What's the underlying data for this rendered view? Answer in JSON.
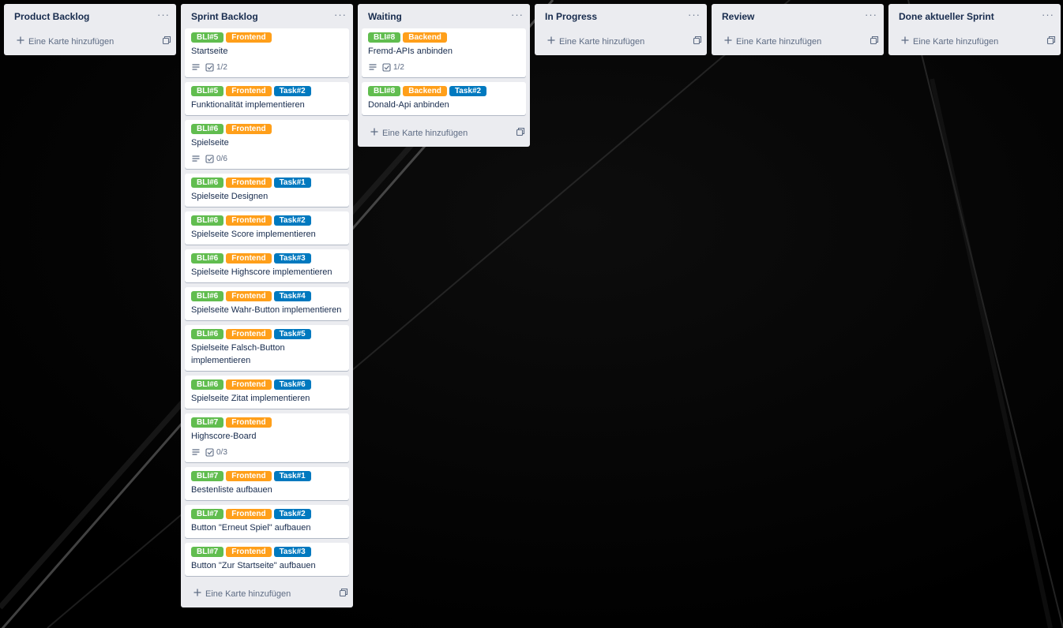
{
  "lists": [
    {
      "title": "Product Backlog",
      "menu_icon": "more-icon",
      "cards": [],
      "add_card_label": "Eine Karte hinzufügen"
    },
    {
      "title": "Sprint Backlog",
      "menu_icon": "more-icon",
      "cards": [
        {
          "labels": [
            {
              "text": "BLI#5",
              "kind": "bli"
            },
            {
              "text": "Frontend",
              "kind": "area"
            }
          ],
          "title": "Startseite",
          "has_description": true,
          "checklist": "1/2"
        },
        {
          "labels": [
            {
              "text": "BLI#5",
              "kind": "bli"
            },
            {
              "text": "Frontend",
              "kind": "area"
            },
            {
              "text": "Task#2",
              "kind": "task"
            }
          ],
          "title": "Funktionalität implementieren"
        },
        {
          "labels": [
            {
              "text": "BLI#6",
              "kind": "bli"
            },
            {
              "text": "Frontend",
              "kind": "area"
            }
          ],
          "title": "Spielseite",
          "has_description": true,
          "checklist": "0/6"
        },
        {
          "labels": [
            {
              "text": "BLI#6",
              "kind": "bli"
            },
            {
              "text": "Frontend",
              "kind": "area"
            },
            {
              "text": "Task#1",
              "kind": "task"
            }
          ],
          "title": "Spielseite Designen"
        },
        {
          "labels": [
            {
              "text": "BLI#6",
              "kind": "bli"
            },
            {
              "text": "Frontend",
              "kind": "area"
            },
            {
              "text": "Task#2",
              "kind": "task"
            }
          ],
          "title": "Spielseite Score implementieren"
        },
        {
          "labels": [
            {
              "text": "BLI#6",
              "kind": "bli"
            },
            {
              "text": "Frontend",
              "kind": "area"
            },
            {
              "text": "Task#3",
              "kind": "task"
            }
          ],
          "title": "Spielseite Highscore implementieren"
        },
        {
          "labels": [
            {
              "text": "BLI#6",
              "kind": "bli"
            },
            {
              "text": "Frontend",
              "kind": "area"
            },
            {
              "text": "Task#4",
              "kind": "task"
            }
          ],
          "title": "Spielseite Wahr-Button implementieren"
        },
        {
          "labels": [
            {
              "text": "BLI#6",
              "kind": "bli"
            },
            {
              "text": "Frontend",
              "kind": "area"
            },
            {
              "text": "Task#5",
              "kind": "task"
            }
          ],
          "title": "Spielseite Falsch-Button implementieren"
        },
        {
          "labels": [
            {
              "text": "BLI#6",
              "kind": "bli"
            },
            {
              "text": "Frontend",
              "kind": "area"
            },
            {
              "text": "Task#6",
              "kind": "task"
            }
          ],
          "title": "Spielseite Zitat implementieren"
        },
        {
          "labels": [
            {
              "text": "BLI#7",
              "kind": "bli"
            },
            {
              "text": "Frontend",
              "kind": "area"
            }
          ],
          "title": "Highscore-Board",
          "has_description": true,
          "checklist": "0/3"
        },
        {
          "labels": [
            {
              "text": "BLI#7",
              "kind": "bli"
            },
            {
              "text": "Frontend",
              "kind": "area"
            },
            {
              "text": "Task#1",
              "kind": "task"
            }
          ],
          "title": "Bestenliste aufbauen"
        },
        {
          "labels": [
            {
              "text": "BLI#7",
              "kind": "bli"
            },
            {
              "text": "Frontend",
              "kind": "area"
            },
            {
              "text": "Task#2",
              "kind": "task"
            }
          ],
          "title": "Button \"Erneut Spiel\" aufbauen"
        },
        {
          "labels": [
            {
              "text": "BLI#7",
              "kind": "bli"
            },
            {
              "text": "Frontend",
              "kind": "area"
            },
            {
              "text": "Task#3",
              "kind": "task"
            }
          ],
          "title": "Button \"Zur Startseite\" aufbauen"
        }
      ],
      "add_card_label": "Eine Karte hinzufügen"
    },
    {
      "title": "Waiting",
      "menu_icon": "more-icon",
      "cards": [
        {
          "labels": [
            {
              "text": "BLI#8",
              "kind": "bli"
            },
            {
              "text": "Backend",
              "kind": "area"
            }
          ],
          "title": "Fremd-APIs anbinden",
          "has_description": true,
          "checklist": "1/2"
        },
        {
          "labels": [
            {
              "text": "BLI#8",
              "kind": "bli"
            },
            {
              "text": "Backend",
              "kind": "area"
            },
            {
              "text": "Task#2",
              "kind": "task"
            }
          ],
          "title": "Donald-Api anbinden"
        }
      ],
      "add_card_label": "Eine Karte hinzufügen"
    },
    {
      "title": "In Progress",
      "menu_icon": "more-icon",
      "cards": [],
      "add_card_label": "Eine Karte hinzufügen"
    },
    {
      "title": "Review",
      "menu_icon": "more-icon",
      "cards": [],
      "add_card_label": "Eine Karte hinzufügen"
    },
    {
      "title": "Done aktueller Sprint",
      "menu_icon": "more-icon",
      "cards": [],
      "add_card_label": "Eine Karte hinzufügen"
    }
  ],
  "colors": {
    "board_background": "#000000",
    "list_background": "#ebecf0",
    "label_bli": "#61bd4f",
    "label_area": "#ff9f1a",
    "label_task": "#0079bf"
  }
}
